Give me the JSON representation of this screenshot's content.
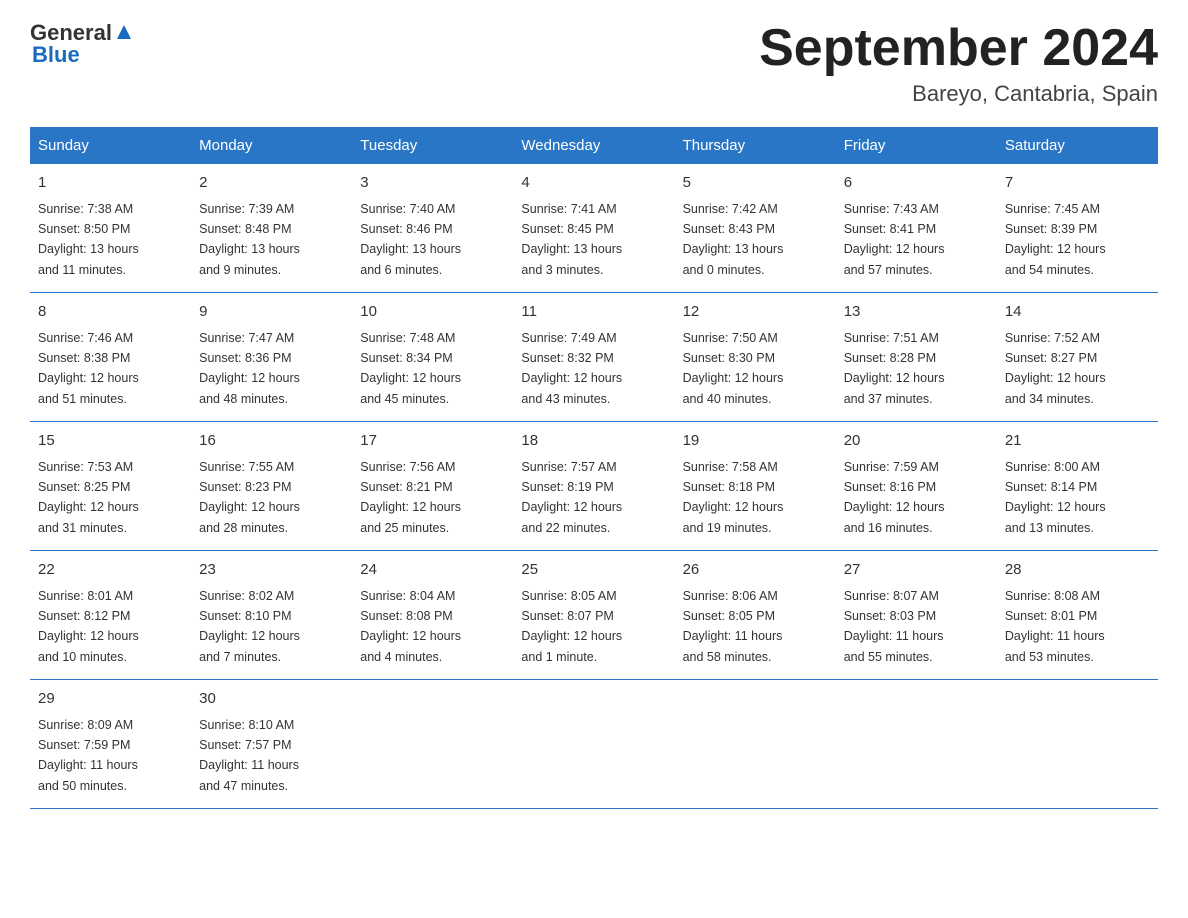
{
  "logo": {
    "general": "General",
    "blue": "Blue"
  },
  "title": "September 2024",
  "subtitle": "Bareyo, Cantabria, Spain",
  "weekdays": [
    "Sunday",
    "Monday",
    "Tuesday",
    "Wednesday",
    "Thursday",
    "Friday",
    "Saturday"
  ],
  "weeks": [
    [
      {
        "day": "1",
        "sunrise": "7:38 AM",
        "sunset": "8:50 PM",
        "daylight": "13 hours and 11 minutes."
      },
      {
        "day": "2",
        "sunrise": "7:39 AM",
        "sunset": "8:48 PM",
        "daylight": "13 hours and 9 minutes."
      },
      {
        "day": "3",
        "sunrise": "7:40 AM",
        "sunset": "8:46 PM",
        "daylight": "13 hours and 6 minutes."
      },
      {
        "day": "4",
        "sunrise": "7:41 AM",
        "sunset": "8:45 PM",
        "daylight": "13 hours and 3 minutes."
      },
      {
        "day": "5",
        "sunrise": "7:42 AM",
        "sunset": "8:43 PM",
        "daylight": "13 hours and 0 minutes."
      },
      {
        "day": "6",
        "sunrise": "7:43 AM",
        "sunset": "8:41 PM",
        "daylight": "12 hours and 57 minutes."
      },
      {
        "day": "7",
        "sunrise": "7:45 AM",
        "sunset": "8:39 PM",
        "daylight": "12 hours and 54 minutes."
      }
    ],
    [
      {
        "day": "8",
        "sunrise": "7:46 AM",
        "sunset": "8:38 PM",
        "daylight": "12 hours and 51 minutes."
      },
      {
        "day": "9",
        "sunrise": "7:47 AM",
        "sunset": "8:36 PM",
        "daylight": "12 hours and 48 minutes."
      },
      {
        "day": "10",
        "sunrise": "7:48 AM",
        "sunset": "8:34 PM",
        "daylight": "12 hours and 45 minutes."
      },
      {
        "day": "11",
        "sunrise": "7:49 AM",
        "sunset": "8:32 PM",
        "daylight": "12 hours and 43 minutes."
      },
      {
        "day": "12",
        "sunrise": "7:50 AM",
        "sunset": "8:30 PM",
        "daylight": "12 hours and 40 minutes."
      },
      {
        "day": "13",
        "sunrise": "7:51 AM",
        "sunset": "8:28 PM",
        "daylight": "12 hours and 37 minutes."
      },
      {
        "day": "14",
        "sunrise": "7:52 AM",
        "sunset": "8:27 PM",
        "daylight": "12 hours and 34 minutes."
      }
    ],
    [
      {
        "day": "15",
        "sunrise": "7:53 AM",
        "sunset": "8:25 PM",
        "daylight": "12 hours and 31 minutes."
      },
      {
        "day": "16",
        "sunrise": "7:55 AM",
        "sunset": "8:23 PM",
        "daylight": "12 hours and 28 minutes."
      },
      {
        "day": "17",
        "sunrise": "7:56 AM",
        "sunset": "8:21 PM",
        "daylight": "12 hours and 25 minutes."
      },
      {
        "day": "18",
        "sunrise": "7:57 AM",
        "sunset": "8:19 PM",
        "daylight": "12 hours and 22 minutes."
      },
      {
        "day": "19",
        "sunrise": "7:58 AM",
        "sunset": "8:18 PM",
        "daylight": "12 hours and 19 minutes."
      },
      {
        "day": "20",
        "sunrise": "7:59 AM",
        "sunset": "8:16 PM",
        "daylight": "12 hours and 16 minutes."
      },
      {
        "day": "21",
        "sunrise": "8:00 AM",
        "sunset": "8:14 PM",
        "daylight": "12 hours and 13 minutes."
      }
    ],
    [
      {
        "day": "22",
        "sunrise": "8:01 AM",
        "sunset": "8:12 PM",
        "daylight": "12 hours and 10 minutes."
      },
      {
        "day": "23",
        "sunrise": "8:02 AM",
        "sunset": "8:10 PM",
        "daylight": "12 hours and 7 minutes."
      },
      {
        "day": "24",
        "sunrise": "8:04 AM",
        "sunset": "8:08 PM",
        "daylight": "12 hours and 4 minutes."
      },
      {
        "day": "25",
        "sunrise": "8:05 AM",
        "sunset": "8:07 PM",
        "daylight": "12 hours and 1 minute."
      },
      {
        "day": "26",
        "sunrise": "8:06 AM",
        "sunset": "8:05 PM",
        "daylight": "11 hours and 58 minutes."
      },
      {
        "day": "27",
        "sunrise": "8:07 AM",
        "sunset": "8:03 PM",
        "daylight": "11 hours and 55 minutes."
      },
      {
        "day": "28",
        "sunrise": "8:08 AM",
        "sunset": "8:01 PM",
        "daylight": "11 hours and 53 minutes."
      }
    ],
    [
      {
        "day": "29",
        "sunrise": "8:09 AM",
        "sunset": "7:59 PM",
        "daylight": "11 hours and 50 minutes."
      },
      {
        "day": "30",
        "sunrise": "8:10 AM",
        "sunset": "7:57 PM",
        "daylight": "11 hours and 47 minutes."
      },
      null,
      null,
      null,
      null,
      null
    ]
  ],
  "labels": {
    "sunrise": "Sunrise:",
    "sunset": "Sunset:",
    "daylight": "Daylight:"
  }
}
